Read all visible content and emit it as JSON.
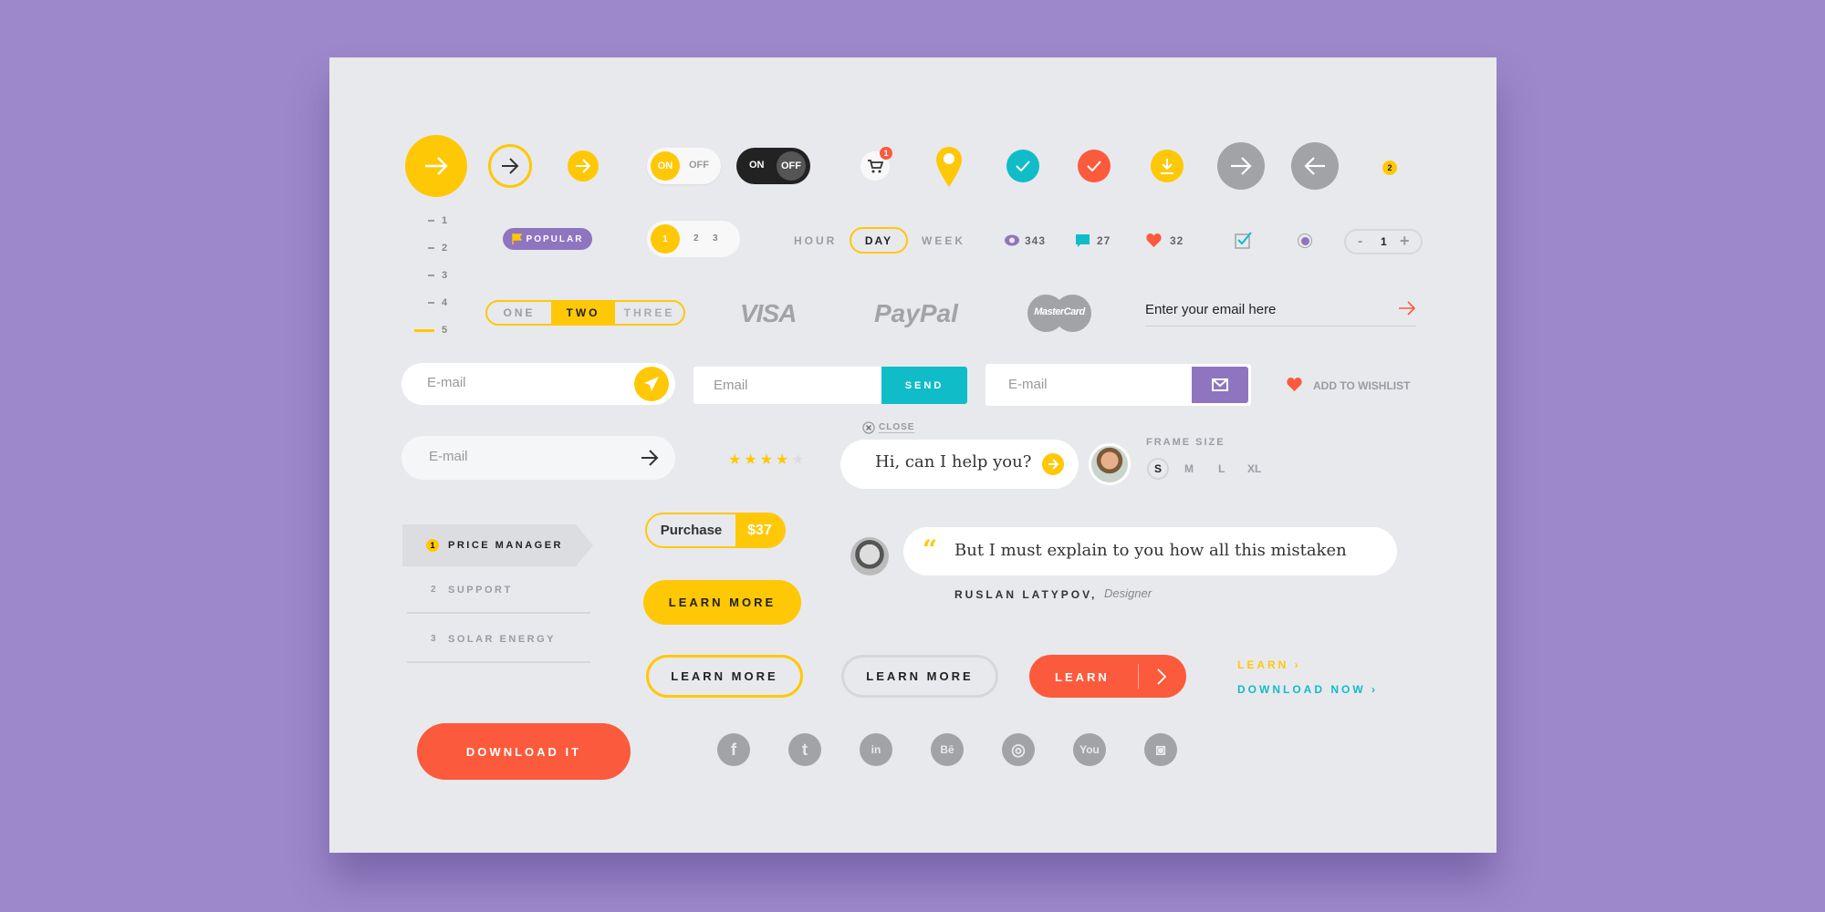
{
  "colors": {
    "yellow": "#ffc806",
    "teal": "#10bcc8",
    "red": "#fb5a3c",
    "purple": "#8f74c0",
    "gray": "#a1a3a7",
    "dark": "#222222",
    "background": "#9d88cb",
    "card": "#e8e9ed"
  },
  "toggles": [
    {
      "on": "ON",
      "off": "OFF",
      "state": "on"
    },
    {
      "on": "ON",
      "off": "OFF",
      "state": "off"
    }
  ],
  "cart": {
    "badge": "1"
  },
  "badge": {
    "count": "2"
  },
  "steps": [
    "1",
    "2",
    "3",
    "4",
    "5"
  ],
  "steps_active": "5",
  "popular": "POPULAR",
  "pager": [
    "1",
    "2",
    "3"
  ],
  "period": {
    "options": [
      "HOUR",
      "DAY",
      "WEEK"
    ],
    "selected": "DAY"
  },
  "stats": {
    "views": "343",
    "comments": "27",
    "likes": "32"
  },
  "checkbox": {
    "checked": true
  },
  "radio": {
    "selected": true
  },
  "stepper": {
    "minus": "-",
    "value": "1",
    "plus": "+"
  },
  "segmented": {
    "options": [
      "ONE",
      "TWO",
      "THREE"
    ],
    "selected": "TWO"
  },
  "payments": {
    "visa": "VISA",
    "paypal": "PayPal",
    "mastercard": "MasterCard"
  },
  "newsletter": {
    "placeholder": "Enter your email here"
  },
  "inputs": {
    "email1": "E-mail",
    "email2": "Email",
    "send": "SEND",
    "email3": "E-mail",
    "email4": "E-mail"
  },
  "wishlist": "ADD TO WISHLIST",
  "rating": {
    "value": 4,
    "max": 5
  },
  "chat": {
    "close": "CLOSE",
    "message": "Hi, can I help you?"
  },
  "frame_size": {
    "label": "FRAME SIZE",
    "options": [
      "S",
      "M",
      "L",
      "XL"
    ],
    "selected": "S"
  },
  "menu": [
    {
      "num": "1",
      "label": "PRICE MANAGER",
      "active": true
    },
    {
      "num": "2",
      "label": "SUPPORT"
    },
    {
      "num": "3",
      "label": "SOLAR ENERGY"
    }
  ],
  "purchase": {
    "label": "Purchase",
    "price": "$37"
  },
  "quote": {
    "text": "But I must explain to you how all this mistaken",
    "author": "RUSLAN LATYPOV,",
    "role": "Designer"
  },
  "buttons": {
    "learn_more_filled": "LEARN MORE",
    "learn_more_outline_yellow": "LEARN MORE",
    "learn_more_outline_gray": "LEARN MORE",
    "learn": "LEARN",
    "download_it": "DOWNLOAD IT"
  },
  "links": {
    "learn": "LEARN ›",
    "download_now": "DOWNLOAD NOW ›"
  },
  "social": [
    "facebook",
    "twitter",
    "linkedin",
    "behance",
    "dribbble",
    "youtube",
    "instagram"
  ],
  "social_glyphs": [
    "f",
    "t",
    "in",
    "Bē",
    "◎",
    "You",
    "◙"
  ]
}
